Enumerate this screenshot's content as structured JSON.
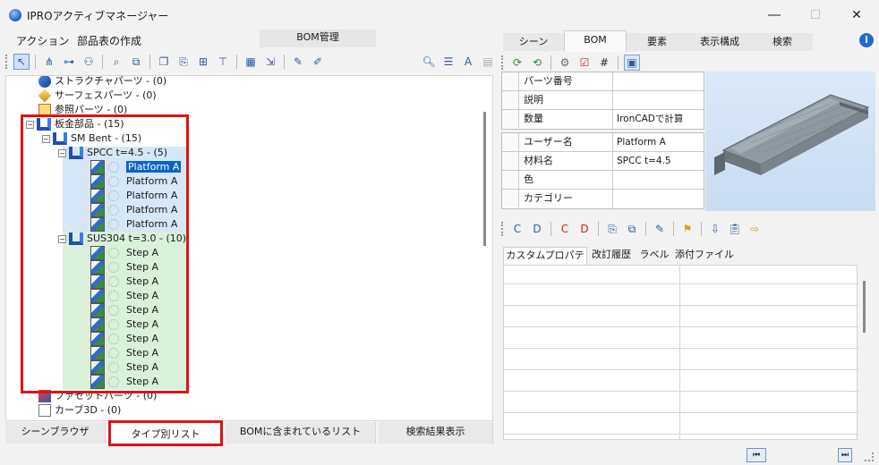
{
  "window": {
    "title": "IPROアクティブマネージャー",
    "controls": [
      "minimize-icon",
      "maximize-icon",
      "close-icon"
    ]
  },
  "menu": {
    "items": [
      "アクション",
      "部品表の作成"
    ],
    "bom_tab": "BOM管理"
  },
  "tree": {
    "top_items": [
      {
        "label": "ストラクチャパーツ - (0)",
        "icon": "structure-icon"
      },
      {
        "label": "サーフェスパーツ - (0)",
        "icon": "surface-icon"
      },
      {
        "label": "参照パーツ - (0)",
        "icon": "reference-icon"
      }
    ],
    "sheet_metal": "板金部品 - (15)",
    "sm_bent": "SM Bent - (15)",
    "spcc": "SPCC t=4.5 - (5)",
    "spcc_items": [
      "Platform A",
      "Platform A",
      "Platform A",
      "Platform A",
      "Platform A"
    ],
    "sus": "SUS304 t=3.0 - (10)",
    "sus_items": [
      "Step A",
      "Step A",
      "Step A",
      "Step A",
      "Step A",
      "Step A",
      "Step A",
      "Step A",
      "Step A",
      "Step A"
    ],
    "facet": "ファセットパーツ - (0)",
    "curve": "カーブ3D - (0)"
  },
  "bottom_tabs": [
    "シーンブラウザ",
    "タイプ別リスト",
    "BOMに含まれているリスト",
    "検索結果表示"
  ],
  "right_tabs": [
    "シーン",
    "BOM",
    "要素",
    "表示構成",
    "検索"
  ],
  "properties": {
    "group1": [
      {
        "key": "パーツ番号",
        "value": ""
      },
      {
        "key": "説明",
        "value": ""
      },
      {
        "key": "数量",
        "value": "IronCADで計算"
      }
    ],
    "group2": [
      {
        "key": "ユーザー名",
        "value": "Platform A"
      },
      {
        "key": "材料名",
        "value": "SPCC t=4.5"
      },
      {
        "key": "色",
        "value": ""
      },
      {
        "key": "カテゴリー",
        "value": ""
      }
    ]
  },
  "sub_tabs": [
    "カスタムプロパティ",
    "改訂履歴",
    "ラベル",
    "添付ファイル"
  ],
  "colors": {
    "highlight_red": "#e21212",
    "selection_blue": "#0b63c6",
    "spcc_band": "#d6e7f7",
    "sus_band": "#d9f0d9"
  }
}
